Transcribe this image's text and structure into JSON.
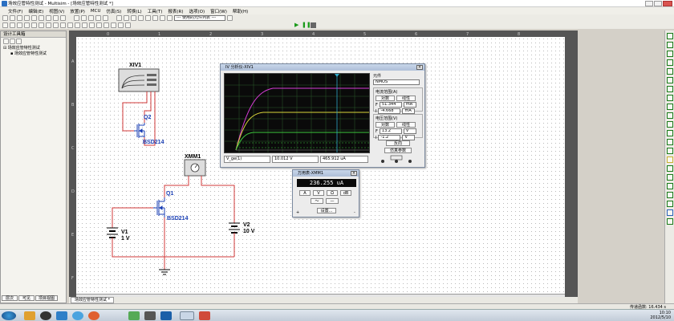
{
  "window": {
    "title": "场效应管特性测试 - Multisim - [场效应管特性测试 *]"
  },
  "menu": [
    "文件(F)",
    "编辑(E)",
    "视图(V)",
    "放置(P)",
    "MCU",
    "仿真(S)",
    "转换(L)",
    "工具(T)",
    "报表(R)",
    "选项(O)",
    "窗口(W)",
    "帮助(H)"
  ],
  "toolbar": {
    "component_combo": "--- 使用的元件列表 ---"
  },
  "design_toolbox": {
    "title": "设计工具箱",
    "tree_root": "场效应管特性测试",
    "tree_child": "场效应管特性测试",
    "tabs": [
      "层次",
      "可见",
      "项目视图"
    ]
  },
  "ruler": {
    "top": [
      "0",
      "1",
      "2",
      "3",
      "4",
      "5",
      "6",
      "7",
      "8"
    ],
    "left": [
      "A",
      "B",
      "C",
      "D",
      "E",
      "F"
    ]
  },
  "schematic": {
    "xiv_label": "XIV1",
    "q2_label": "Q2",
    "q2_model": "BSD214",
    "xmm_label": "XMM1",
    "q1_label": "Q1",
    "q1_model": "BSD214",
    "v1_label": "V1",
    "v1_value": "1 V",
    "v2_label": "V2",
    "v2_value": "10 V"
  },
  "iv_analyzer": {
    "title": "IV 分析仪-XIV1",
    "component_label": "元件",
    "component_value": "NMOS",
    "current_range_title": "电流范围(A)",
    "log_label": "对数",
    "linear_label": "线性",
    "f_label": "F",
    "f_value": "51.344",
    "f_unit": "mA",
    "i_label": "I",
    "i_value": "-4.668",
    "i_unit": "mA",
    "voltage_range_title": "电压范围(V)",
    "log_label2": "对数",
    "linear_label2": "线性",
    "vf_label": "F",
    "vf_value": "13.2",
    "vf_unit": "V",
    "vi_label": "I",
    "vi_value": "-1.2",
    "vi_unit": "V",
    "reverse_btn": "反向",
    "sim_params_btn": "仿真参数",
    "readout_left": "V_ge(1)",
    "readout_mid": "10.012  V",
    "readout_right": "465.912 uA"
  },
  "multimeter": {
    "title": "万用表-XMM1",
    "display": "236.255 uA",
    "mode_buttons": [
      "A",
      "V",
      "Ω",
      "dB"
    ],
    "set_button": "设置...",
    "plus": "+",
    "minus": "-"
  },
  "tabs": {
    "active": "场效应管特性测试 *"
  },
  "status": {
    "sim_time": "传递函数: 16.434 s"
  },
  "clock": {
    "time": "10:10",
    "date": "2012/5/10"
  },
  "colors": {
    "wire": "#d23a3a",
    "component": "#1a3fb5",
    "label": "#000000",
    "scope_bg": "#0a0a0a",
    "curve_magenta": "#d63cd6",
    "curve_yellow": "#d8d43a",
    "curve_green": "#3cc43c"
  }
}
